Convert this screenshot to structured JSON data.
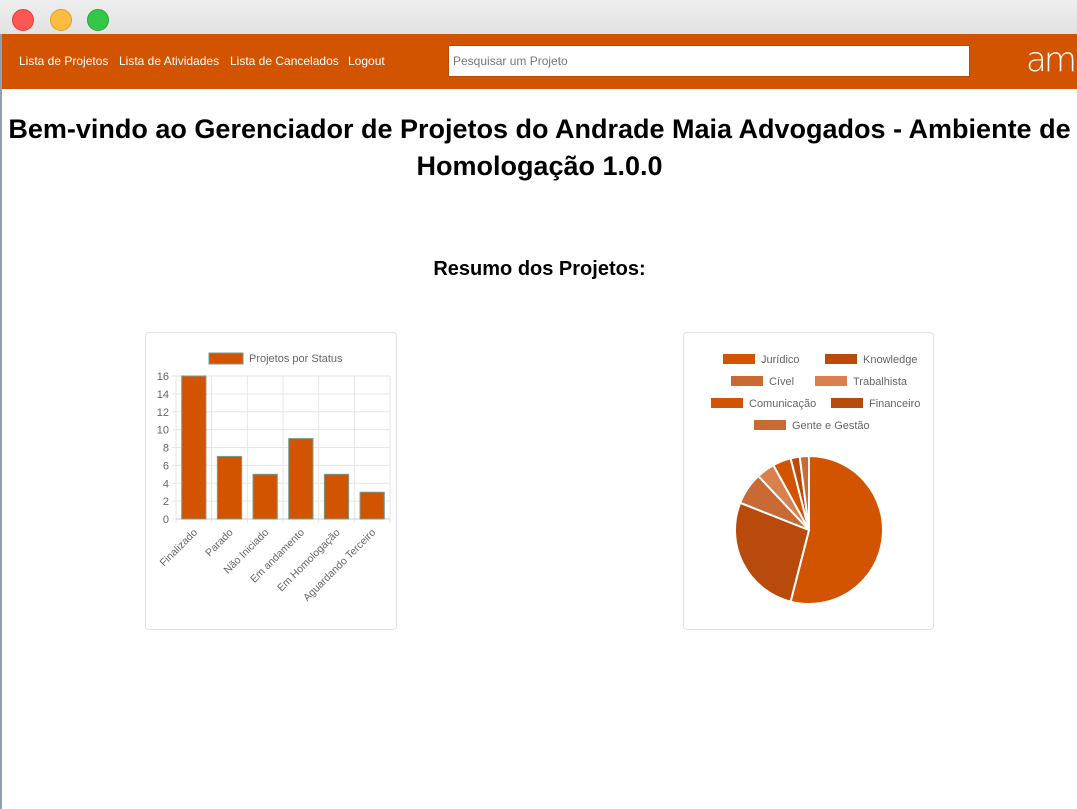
{
  "window": {},
  "nav": {
    "links": [
      "Lista de Projetos",
      "Lista de Atividades",
      "Lista de Cancelados",
      "Logout"
    ],
    "search_placeholder": "Pesquisar um Projeto",
    "logo_text": "am"
  },
  "header": {
    "title": "Bem-vindo ao Gerenciador de Projetos do Andrade Maia Advogados - Ambiente de Homologação 1.0.0",
    "section_title": "Resumo dos Projetos:"
  },
  "colors": {
    "brand": "#d35400",
    "bar_fill": "#d35400",
    "bar_border": "#7a9a8a"
  },
  "chart_data": [
    {
      "type": "bar",
      "categories": [
        "Finalizado",
        "Parado",
        "Não Iniciado",
        "Em andamento",
        "Em Homologação",
        "Aguardando Terceiro"
      ],
      "series": [
        {
          "name": "Projetos por Status",
          "values": [
            16,
            7,
            5,
            9,
            5,
            3
          ]
        }
      ],
      "ylim": [
        0,
        16
      ],
      "yticks": [
        0,
        2,
        4,
        6,
        8,
        10,
        12,
        14,
        16
      ],
      "legend": "top",
      "grid": true
    },
    {
      "type": "pie",
      "labels": [
        "Jurídico",
        "Knowledge",
        "Cível",
        "Trabalhista",
        "Comunicação",
        "Financeiro",
        "Gente e Gestão"
      ],
      "values": [
        54,
        27,
        7,
        4,
        4,
        2,
        2
      ],
      "colors": [
        "#d35400",
        "#b84b0c",
        "#c96a34",
        "#d98050",
        "#d35400",
        "#b84b0c",
        "#c96a34"
      ],
      "legend": "top"
    }
  ]
}
